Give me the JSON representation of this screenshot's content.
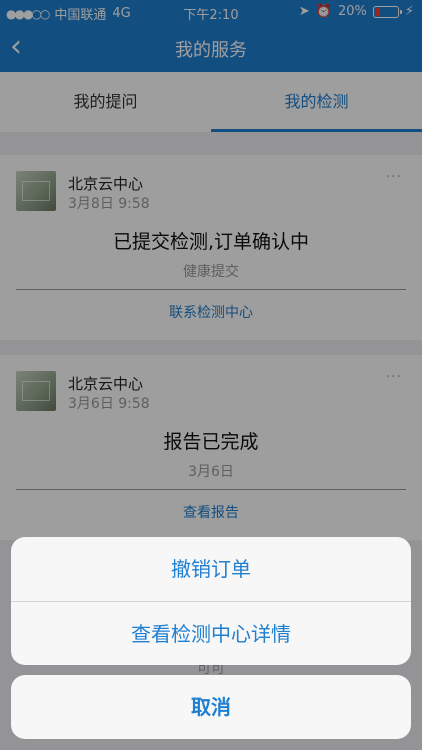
{
  "status_bar": {
    "carrier": "中国联通",
    "network": "4G",
    "time": "下午2:10",
    "battery": "20%",
    "battery_level": 0.2,
    "signal_dots": "●●●○○"
  },
  "nav": {
    "back_icon": "chevron-left-icon",
    "title": "我的服务"
  },
  "tabs": [
    {
      "label": "我的提问",
      "active": false
    },
    {
      "label": "我的检测",
      "active": true
    }
  ],
  "cards": [
    {
      "center_name": "北京云中心",
      "time": "3月8日 9:58",
      "status": "已提交检测,订单确认中",
      "sub": "健康提交",
      "action": "联系检测中心",
      "more": "···"
    },
    {
      "center_name": "北京云中心",
      "time": "3月6日 9:58",
      "status": "报告已完成",
      "sub": "3月6日",
      "action": "查看报告",
      "more": "···"
    }
  ],
  "peek_text": "可可",
  "action_sheet": {
    "options": [
      "撤销订单",
      "查看检测中心详情"
    ],
    "cancel": "取消"
  },
  "colors": {
    "accent": "#1f7fd1",
    "battery_low": "#ff3b30"
  }
}
